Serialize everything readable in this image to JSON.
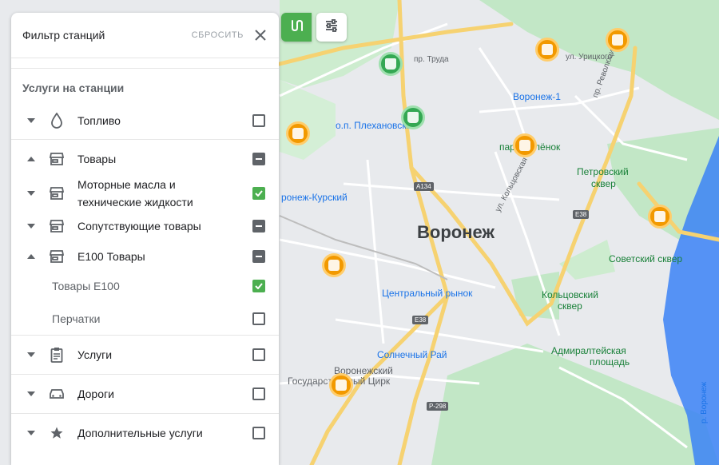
{
  "map": {
    "city_label": "Воронеж",
    "labels": {
      "trud": "пр. Труда",
      "uritskogo": "ул. Урицкого",
      "voronezh1": "Воронеж-1",
      "revolyutsii": "пр. Революции",
      "plekhanovskaya": "о.п. Плехановская",
      "park_oplenok": "парк Орлёнок",
      "petrovsky_1": "Петровский",
      "petrovsky_2": "сквер",
      "koltsovskaya": "ул. Кольцовская",
      "kursky": "ронеж-Курский",
      "a134": "А134",
      "e38_a": "Е38",
      "e38_b": "Е38",
      "e38_c": "Е38",
      "sovetsky": "Советский сквер",
      "central_market": "Центральный рынок",
      "koltsovsky_1": "Кольцовский",
      "koltsovsky_2": "сквер",
      "admiralteyskaya_1": "Адмиралтейская",
      "admiralteyskaya_2": "площадь",
      "solnechny": "Солнечный Рай",
      "circus_1": "Воронежский",
      "circus_2": "Государственный Цирк",
      "r298": "Р-298",
      "river": "р. Воронеж"
    }
  },
  "buttons": {
    "route_icon": "route-icon",
    "settings_icon": "tune-icon"
  },
  "panel": {
    "title": "Фильтр станций",
    "reset": "СБРОСИТЬ",
    "close_icon": "close-icon",
    "section_title": "Услуги на станции",
    "items": [
      {
        "label": "Топливо",
        "icon": "drop-icon",
        "expanded": false,
        "state": "unchecked"
      },
      {
        "label": "Товары",
        "icon": "store-icon",
        "expanded": true,
        "state": "indeterminate"
      },
      {
        "label": "Моторные масла и технические жидкости",
        "label_line1": "Моторные масла и",
        "label_line2": "технические жидкости",
        "icon": "store-icon",
        "expanded": false,
        "state": "checked"
      },
      {
        "label": "Сопутствующие товары",
        "icon": "store-icon",
        "expanded": false,
        "state": "indeterminate"
      },
      {
        "label": "E100 Товары",
        "icon": "store-icon",
        "expanded": true,
        "state": "indeterminate"
      },
      {
        "label": "Товары E100",
        "state": "checked"
      },
      {
        "label": "Перчатки",
        "state": "unchecked"
      },
      {
        "label": "Услуги",
        "icon": "clipboard-icon",
        "expanded": false,
        "state": "unchecked"
      },
      {
        "label": "Дороги",
        "icon": "car-icon",
        "expanded": false,
        "state": "unchecked"
      },
      {
        "label": "Дополнительные услуги",
        "icon": "star-icon",
        "expanded": false,
        "state": "unchecked"
      }
    ]
  },
  "colors": {
    "accent_green": "#4caf50",
    "marker_orange": "#f29900",
    "marker_green": "#34a853",
    "water": "#3b82f6",
    "road_yellow": "#f6d271"
  }
}
